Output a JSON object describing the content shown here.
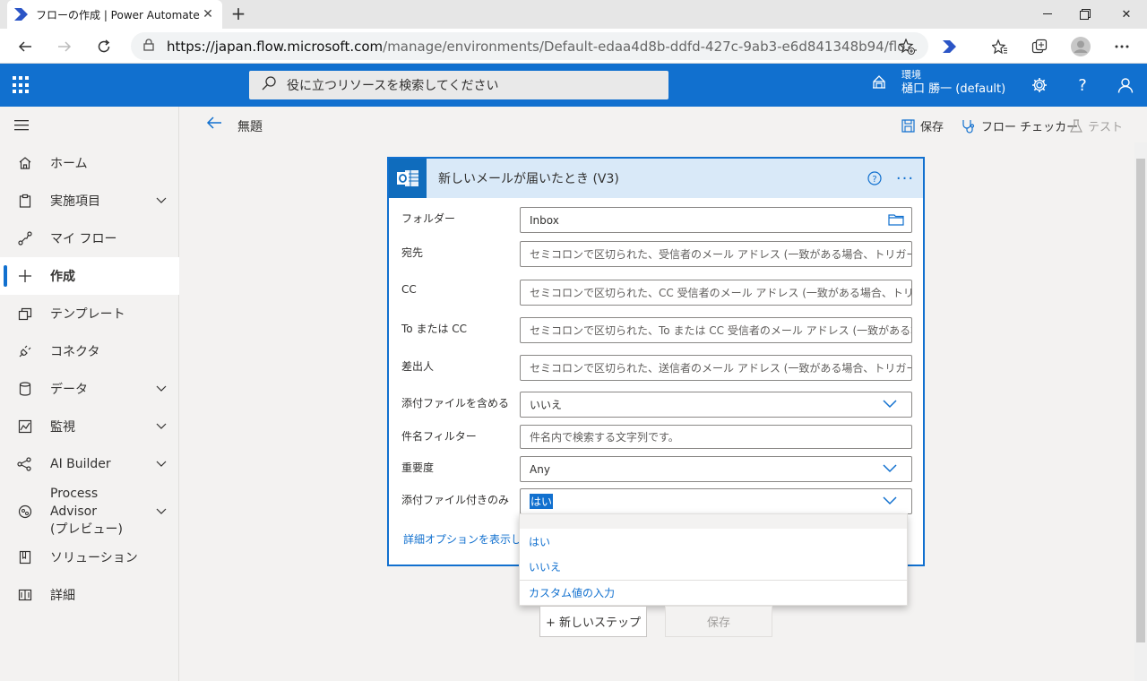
{
  "browser": {
    "tab_title": "フローの作成 | Power Automate",
    "url_host": "https://japan.flow.microsoft.com",
    "url_path": "/manage/environments/Default-edaa4d8b-ddfd-427c-9ab3-e6d841348b94/flo..."
  },
  "header": {
    "search_placeholder": "役に立つリソースを検索してください",
    "env_label": "環境",
    "env_name": "樋口 勝一 (default)"
  },
  "sidebar": {
    "items": [
      {
        "label": "ホーム"
      },
      {
        "label": "実施項目"
      },
      {
        "label": "マイ フロー"
      },
      {
        "label": "作成"
      },
      {
        "label": "テンプレート"
      },
      {
        "label": "コネクタ"
      },
      {
        "label": "データ"
      },
      {
        "label": "監視"
      },
      {
        "label": "AI Builder"
      },
      {
        "label": "Process Advisor"
      },
      {
        "label": "ソリューション"
      },
      {
        "label": "詳細"
      }
    ],
    "process_advisor_sub": "(プレビュー)"
  },
  "commandbar": {
    "flow_name": "無題",
    "save": "保存",
    "checker": "フロー チェッカー",
    "test": "テスト"
  },
  "card": {
    "title": "新しいメールが届いたとき (V3)",
    "fields": [
      {
        "label": "フォルダー",
        "value": "Inbox"
      },
      {
        "label": "宛先",
        "placeholder": "セミコロンで区切られた、受信者のメール アドレス (一致がある場合、トリガーが実"
      },
      {
        "label": "CC",
        "placeholder": "セミコロンで区切られた、CC 受信者のメール アドレス (一致がある場合、トリガー"
      },
      {
        "label": "To または CC",
        "placeholder": "セミコロンで区切られた、To または CC 受信者のメール アドレス (一致がある場"
      },
      {
        "label": "差出人",
        "placeholder": "セミコロンで区切られた、送信者のメール アドレス (一致がある場合、トリガーが実"
      },
      {
        "label": "添付ファイルを含める",
        "value": "いいえ"
      },
      {
        "label": "件名フィルター",
        "placeholder": "件名内で検索する文字列です。"
      },
      {
        "label": "重要度",
        "value": "Any"
      },
      {
        "label": "添付ファイル付きのみ",
        "value": "はい"
      }
    ],
    "advanced": "詳細オプションを表示し"
  },
  "dropdown": {
    "options": [
      "はい",
      "いいえ",
      "カスタム値の入力"
    ]
  },
  "buttons": {
    "new_step": "+ 新しいステップ",
    "save": "保存"
  }
}
